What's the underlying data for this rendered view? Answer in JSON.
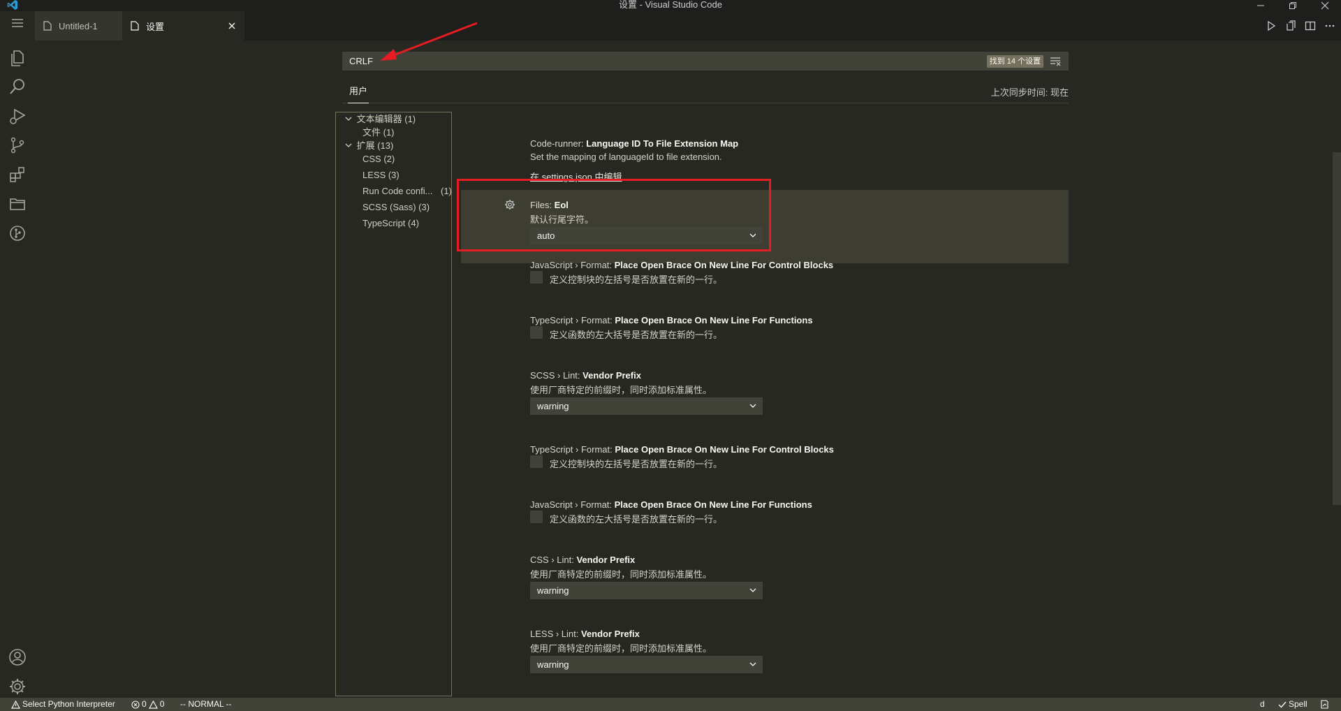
{
  "window": {
    "title": "设置 - Visual Studio Code"
  },
  "tabs": [
    {
      "label": "Untitled-1"
    },
    {
      "label": "设置"
    }
  ],
  "search": {
    "value": "CRLF",
    "result_count": "找到 14 个设置"
  },
  "scope": {
    "user_tab": "用户",
    "sync_status": "上次同步时间: 现在"
  },
  "toc": {
    "items": [
      {
        "label": "文本编辑器 (1)",
        "expanded": true
      },
      {
        "label": "文件 (1)"
      },
      {
        "label": "扩展 (13)",
        "expanded": true
      },
      {
        "label": "CSS (2)"
      },
      {
        "label": "LESS (3)"
      },
      {
        "label": "Run Code confi...",
        "count": "(1)"
      },
      {
        "label": "SCSS (Sass) (3)"
      },
      {
        "label": "TypeScript (4)"
      }
    ]
  },
  "settings": [
    {
      "category": "Code-runner: ",
      "title": "Language ID To File Extension Map",
      "description": "Set the mapping of languageId to file extension.",
      "link": "在 settings.json 中编辑"
    },
    {
      "category": "Files: ",
      "title": "Eol",
      "description": "默认行尾字符。",
      "value": "auto"
    },
    {
      "category": "JavaScript › Format: ",
      "title": "Place Open Brace On New Line For Control Blocks",
      "description": "定义控制块的左括号是否放置在新的一行。"
    },
    {
      "category": "TypeScript › Format: ",
      "title": "Place Open Brace On New Line For Functions",
      "description": "定义函数的左大括号是否放置在新的一行。"
    },
    {
      "category": "SCSS › Lint: ",
      "title": "Vendor Prefix",
      "description": "使用厂商特定的前缀时，同时添加标准属性。",
      "value": "warning"
    },
    {
      "category": "TypeScript › Format: ",
      "title": "Place Open Brace On New Line For Control Blocks",
      "description": "定义控制块的左括号是否放置在新的一行。"
    },
    {
      "category": "JavaScript › Format: ",
      "title": "Place Open Brace On New Line For Functions",
      "description": "定义函数的左大括号是否放置在新的一行。"
    },
    {
      "category": "CSS › Lint: ",
      "title": "Vendor Prefix",
      "description": "使用厂商特定的前缀时，同时添加标准属性。",
      "value": "warning"
    },
    {
      "category": "LESS › Lint: ",
      "title": "Vendor Prefix",
      "description": "使用厂商特定的前缀时，同时添加标准属性。",
      "value": "warning"
    }
  ],
  "statusbar": {
    "python": "Select Python Interpreter",
    "errors": "0",
    "warnings": "0",
    "mode": "-- NORMAL --",
    "right_d": "d",
    "spell": "Spell"
  },
  "colors": {
    "accent_red": "#e51c23",
    "background": "#272822",
    "input_bg": "#414339"
  }
}
